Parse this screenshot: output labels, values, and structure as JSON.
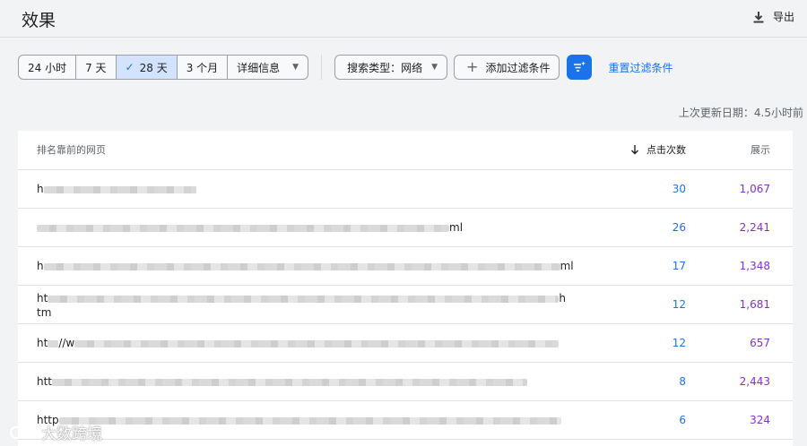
{
  "header": {
    "title": "效果",
    "export_label": "导出"
  },
  "filters": {
    "date_options": [
      {
        "label": "24 小时",
        "active": false
      },
      {
        "label": "7 天",
        "active": false
      },
      {
        "label": "28 天",
        "active": true
      },
      {
        "label": "3 个月",
        "active": false
      },
      {
        "label": "详细信息",
        "active": false
      }
    ],
    "search_type": "搜索类型：网络",
    "add_filter": "添加过滤条件",
    "reset": "重置过滤条件"
  },
  "updated": "上次更新日期：4.5小时前",
  "table": {
    "headers": {
      "page": "排名靠前的网页",
      "clicks": "点击次数",
      "impressions": "展示"
    },
    "rows": [
      {
        "url_start": "h",
        "url_end": "",
        "url_line2": "",
        "clicks": "30",
        "impressions": "1,067"
      },
      {
        "url_start": "",
        "url_end": "ml",
        "url_line2": "",
        "clicks": "26",
        "impressions": "2,241"
      },
      {
        "url_start": "h",
        "url_end": "ml",
        "url_line2": "",
        "clicks": "17",
        "impressions": "1,348"
      },
      {
        "url_start": "ht",
        "url_end": "h",
        "url_line2": "tm",
        "clicks": "12",
        "impressions": "1,681"
      },
      {
        "url_start": "ht",
        "url_end": "//w",
        "url_line2": "",
        "clicks": "12",
        "impressions": "657"
      },
      {
        "url_start": "htt",
        "url_end": "",
        "url_line2": "",
        "clicks": "8",
        "impressions": "2,443"
      },
      {
        "url_start": "http",
        "url_end": "",
        "url_line2": "",
        "clicks": "6",
        "impressions": "324"
      }
    ]
  },
  "watermark": "大数跨境",
  "colors": {
    "accent": "#1a73e8",
    "impressions": "#8430ce",
    "active_chip": "#d3e3fd"
  }
}
